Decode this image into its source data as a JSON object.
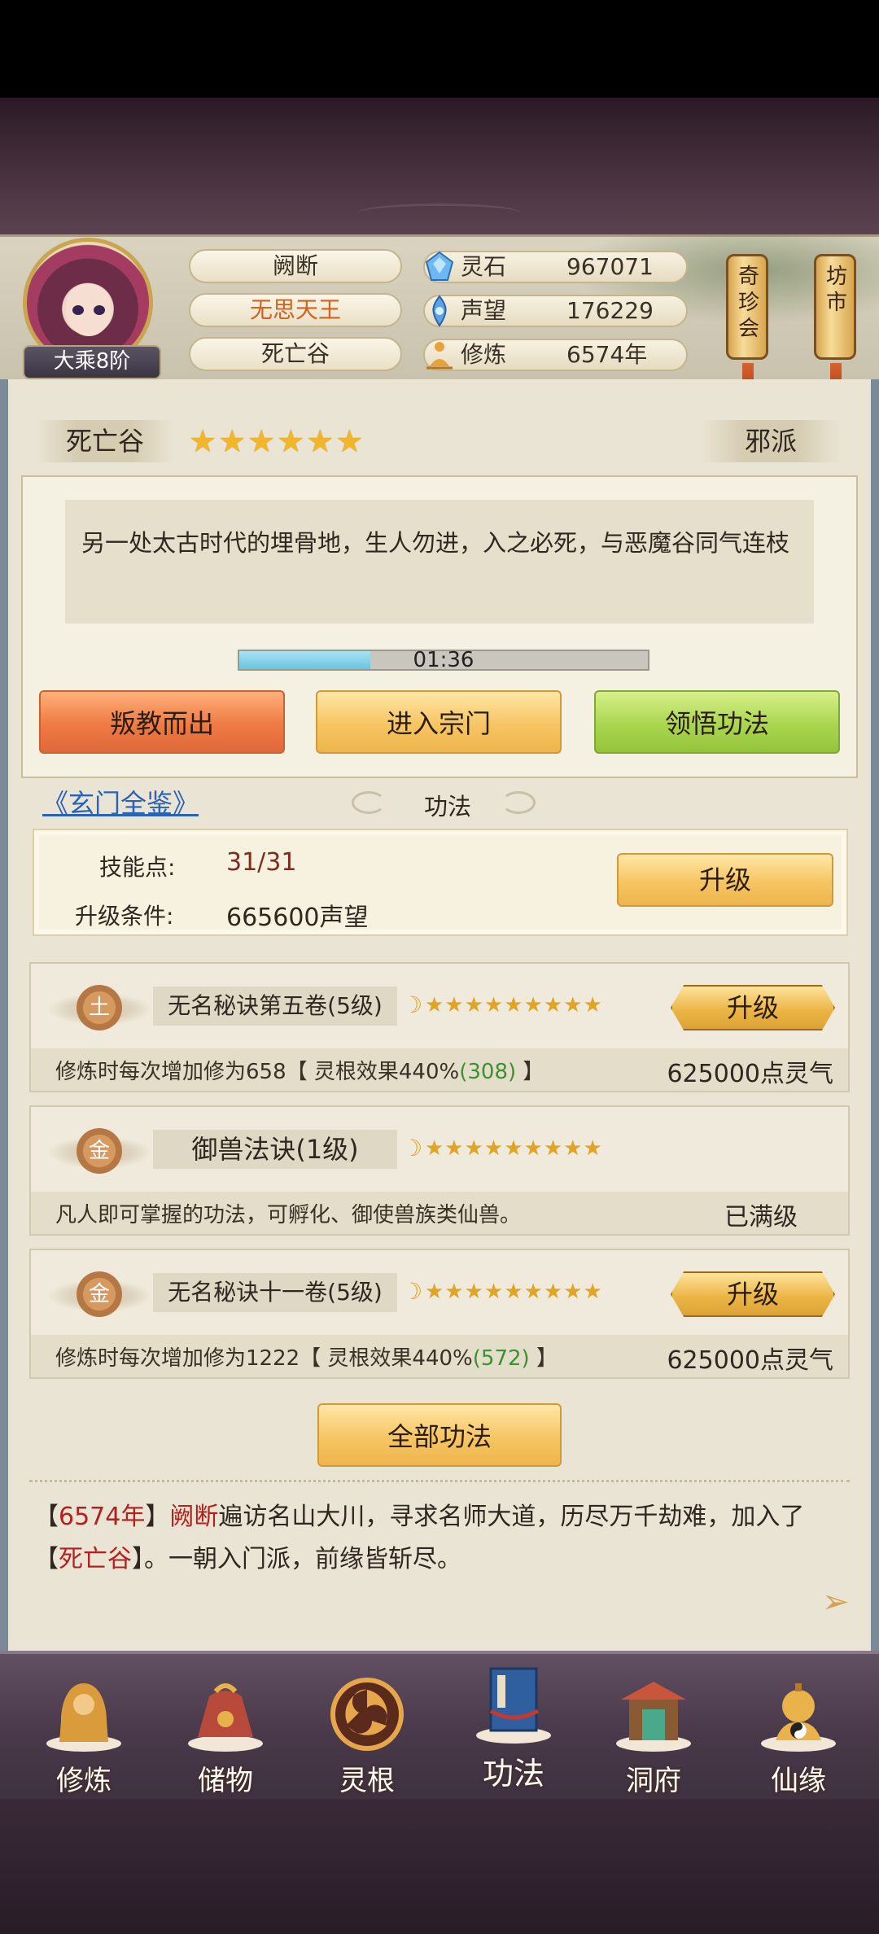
{
  "header": {
    "rank": "大乘8阶",
    "player_name": "阙断",
    "title": "无思天王",
    "sect": "死亡谷",
    "resources": [
      {
        "label": "灵石",
        "value": "967071",
        "icon": "spirit-stone-icon"
      },
      {
        "label": "声望",
        "value": "176229",
        "icon": "reputation-icon"
      },
      {
        "label": "修炼",
        "value": "6574年",
        "icon": "meditation-icon"
      }
    ],
    "scroll_left": "奇珍会",
    "scroll_right": "坊市"
  },
  "sect_panel": {
    "sect_name": "死亡谷",
    "stars": "★★★★★★",
    "star_count": 6,
    "faction": "邪派",
    "description": "另一处太古时代的埋骨地，生人勿进，入之必死，与恶魔谷同气连枝",
    "timer": "01:36",
    "progress": 0.32,
    "buttons": {
      "leave": "叛教而出",
      "enter": "进入宗门",
      "comprehend": "领悟功法"
    }
  },
  "skills_section": {
    "link": "《玄门全鉴》",
    "title": "功法",
    "skill_points_label": "技能点:",
    "skill_points_value": "31/31",
    "upgrade_cond_label": "升级条件:",
    "upgrade_cond_value": "665600声望",
    "upgrade_button": "升级",
    "cards": [
      {
        "element": "土",
        "name": "无名秘诀第五卷(5级)",
        "stars": "★★★★★★★★★",
        "desc_prefix": "修炼时每次增加修为658【 灵根效果440%",
        "desc_bonus": "(308)",
        "desc_suffix": " 】",
        "right": "625000点灵气",
        "button": "升级"
      },
      {
        "element": "金",
        "name": "御兽法诀(1级)",
        "stars": "★★★★★★★★★",
        "desc_prefix": "凡人即可掌握的功法，可孵化、御使兽族类仙兽。",
        "desc_bonus": "",
        "desc_suffix": "",
        "right": "已满级",
        "button": ""
      },
      {
        "element": "金",
        "name": "无名秘诀十一卷(5级)",
        "stars": "★★★★★★★★★",
        "desc_prefix": "修炼时每次增加修为1222【 灵根效果440%",
        "desc_bonus": "(572)",
        "desc_suffix": " 】",
        "right": "625000点灵气",
        "button": "升级"
      }
    ],
    "all_skills_button": "全部功法"
  },
  "log": {
    "year": "6574年",
    "name": "阙断",
    "text1": "遍访名山大川，寻求名师大道，历尽万千劫难，加入了",
    "sect": "死亡谷",
    "text2": "。一朝入门派，前缘皆斩尽。"
  },
  "nav": [
    {
      "label": "修炼",
      "icon": "cultivate-icon"
    },
    {
      "label": "储物",
      "icon": "storage-bag-icon"
    },
    {
      "label": "灵根",
      "icon": "spirit-root-icon"
    },
    {
      "label": "功法",
      "icon": "skill-book-icon"
    },
    {
      "label": "洞府",
      "icon": "cave-mansion-icon"
    },
    {
      "label": "仙缘",
      "icon": "immortal-fate-icon"
    }
  ],
  "colors": {
    "accent_gold": "#f6c562",
    "btn_red": "#ee7a44",
    "btn_green": "#a9d64f",
    "link_blue": "#2a62b7",
    "highlight_red": "#b22020",
    "bonus_green": "#3c9131"
  }
}
